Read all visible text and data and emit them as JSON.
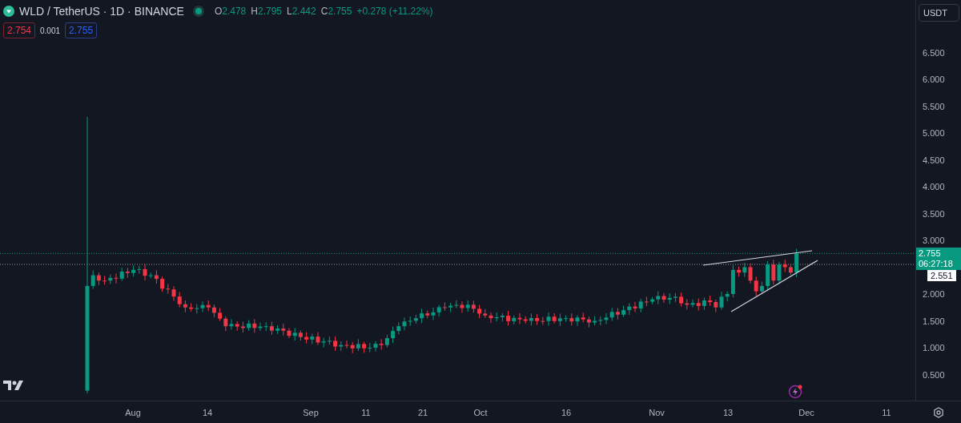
{
  "legend": {
    "title": "WLD / TetherUS · 1D · BINANCE",
    "market_open": true,
    "ohlc": [
      {
        "label": "O",
        "value": "2.478"
      },
      {
        "label": "H",
        "value": "2.795"
      },
      {
        "label": "L",
        "value": "2.442"
      },
      {
        "label": "C",
        "value": "2.755"
      }
    ],
    "change": "+0.278 (+11.22%)",
    "bid": "2.754",
    "spread": "0.001",
    "ask": "2.755"
  },
  "currency_button": "USDT",
  "price_axis": [
    "6.500",
    "6.000",
    "5.500",
    "5.000",
    "4.500",
    "4.000",
    "3.500",
    "3.000",
    "2.000",
    "1.500",
    "1.000",
    "0.500"
  ],
  "last_price": {
    "value": "2.755",
    "countdown": "06:27:18"
  },
  "price_marker": "2.551",
  "time_axis": [
    "Aug",
    "14",
    "Sep",
    "11",
    "21",
    "Oct",
    "16",
    "Nov",
    "13",
    "Dec",
    "11"
  ]
}
